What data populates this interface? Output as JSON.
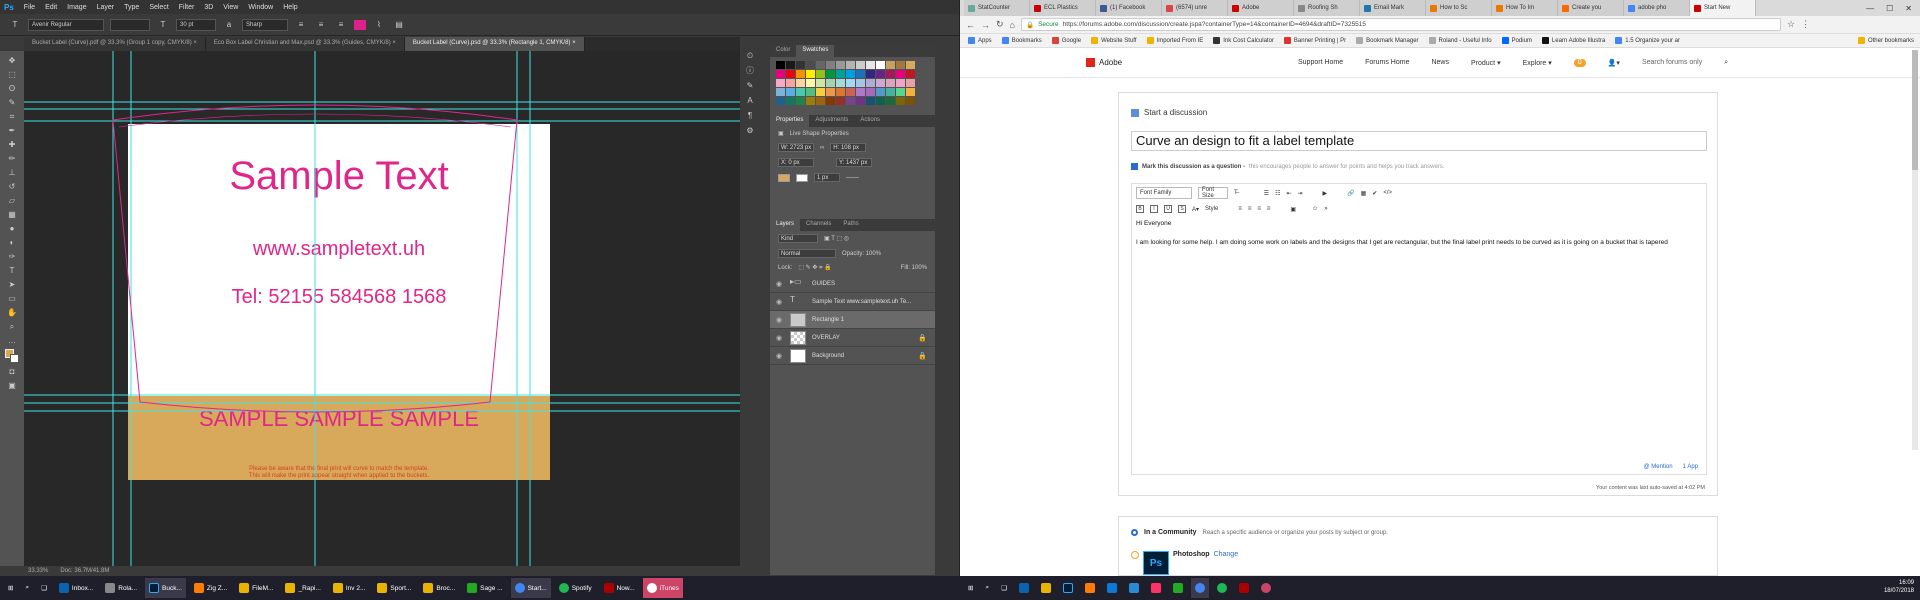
{
  "photoshop": {
    "logo": "Ps",
    "menu": [
      "File",
      "Edit",
      "Image",
      "Layer",
      "Type",
      "Select",
      "Filter",
      "3D",
      "View",
      "Window",
      "Help"
    ],
    "options": {
      "font_family": "Avenir Regular",
      "font_size": "30 pt",
      "aa": "Sharp",
      "text_color": "#e0208a"
    },
    "doc_tabs": [
      {
        "label": "Bucket Label (Curve).pdf @ 33.3% (Group 1 copy, CMYK/8) ×",
        "active": false
      },
      {
        "label": "Eco Box Label Christian and Max.psd @ 33.3% (Guides, CMYK/8) ×",
        "active": false
      },
      {
        "label": "Bucket Label (Curve).psd @ 33.3% (Rectangle 1, CMYK/8) ×",
        "active": true
      }
    ],
    "artboard": {
      "heading": "Sample Text",
      "website": "www.sampletext.uh",
      "tel": "Tel: 52155 584568 1568",
      "band_text": "SAMPLE SAMPLE SAMPLE",
      "band_color": "#d8a95a",
      "disclaimer_line1": "Please be aware that the final print will curve to match the template.",
      "disclaimer_line2": "This will make the print appear straight when applied to the buckets."
    },
    "status": {
      "zoom": "33.33%",
      "doc": "Doc: 36.7M/41.8M"
    },
    "panels": {
      "color_tabs": [
        "Color",
        "Swatches"
      ],
      "props_tabs": [
        "Properties",
        "Adjustments",
        "Actions"
      ],
      "props_title": "Live Shape Properties",
      "w": "W: 2723 px",
      "h": "H: 108 px",
      "x": "X: 0 px",
      "y": "Y: 1437 px",
      "stroke": "1 px",
      "layers_tabs": [
        "Layers",
        "Channels",
        "Paths"
      ],
      "kind": "Kind",
      "blend": "Normal",
      "opacity": "Opacity: 100%",
      "lock": "Lock:",
      "fill": "Fill: 100%",
      "layers": [
        {
          "name": "GUIDES",
          "type": "folder",
          "selected": false,
          "locked": false
        },
        {
          "name": "Sample Text  www.sampletext.uh  Te...",
          "type": "text",
          "selected": false,
          "locked": false
        },
        {
          "name": "Rectangle 1",
          "type": "shape",
          "selected": true,
          "locked": false
        },
        {
          "name": "OVERLAY",
          "type": "checker",
          "selected": false,
          "locked": true
        },
        {
          "name": "Background",
          "type": "white",
          "selected": false,
          "locked": true
        }
      ]
    }
  },
  "chrome": {
    "tabs": [
      {
        "label": "StatCounter",
        "active": false
      },
      {
        "label": "ECL Plastics",
        "active": false
      },
      {
        "label": "(1) Facebook",
        "active": false
      },
      {
        "label": "(6574) unre",
        "active": false
      },
      {
        "label": "Adobe",
        "active": false
      },
      {
        "label": "Roofing Sh",
        "active": false
      },
      {
        "label": "Email Mark",
        "active": false
      },
      {
        "label": "How to Sc",
        "active": false
      },
      {
        "label": "How To Im",
        "active": false
      },
      {
        "label": "Create you",
        "active": false
      },
      {
        "label": "adobe pho",
        "active": false
      },
      {
        "label": "Start New",
        "active": true
      }
    ],
    "url": "https://forums.adobe.com/discussion/create.jspa?containerType=14&containerID=4694&draftID=7325515",
    "secure_label": "Secure",
    "bookmarks": [
      "Apps",
      "Bookmarks",
      "Google",
      "Website Stuff",
      "Imported From IE",
      "Ink Cost Calculator",
      "Banner Printing | Pr",
      "Bookmark Manager",
      "Roland - Useful Info",
      "Podium",
      "Learn Adobe Illustra",
      "1.5 Organize your ar",
      "Other bookmarks"
    ],
    "adobe": {
      "brand": "Adobe",
      "nav": [
        "Support Home",
        "Forums Home",
        "News",
        "Product ▾",
        "Explore ▾"
      ],
      "notif": "0",
      "search": "Search forums only"
    },
    "discussion": {
      "header": "Start a discussion",
      "title": "Curve an design to fit a label template",
      "question_label": "Mark this discussion as a question -",
      "question_hint": "this encourages people to answer for points and helps you track answers.",
      "font_family": "Font Family",
      "font_size": "Font Size",
      "style": "Style",
      "greeting": "Hi Everyone",
      "body": "I am looking for some help.  I am doing some work on labels and the designs that I get are rectangular, but the final label print needs to be curved as it is going on a bucket that is tapered",
      "mention": "@ Mention",
      "app": "1 App",
      "autosave": "Your content was last auto-saved at 4:02 PM"
    },
    "community": {
      "label": "In a Community",
      "hint": "Reach a specific audience or organize your posts by subject or group.",
      "product": "Photoshop",
      "change": "Change"
    }
  },
  "taskbar": {
    "left": [
      "Inbox...",
      "Rola...",
      "Buck...",
      "Zig Z...",
      "FileM...",
      "_Rapi...",
      "Inv 2...",
      "Sport...",
      "Broc...",
      "Sage ...",
      "Start...",
      "Spotify",
      "Now...",
      "iTunes"
    ],
    "right_time": "16:09",
    "right_date": "18/07/2018"
  }
}
